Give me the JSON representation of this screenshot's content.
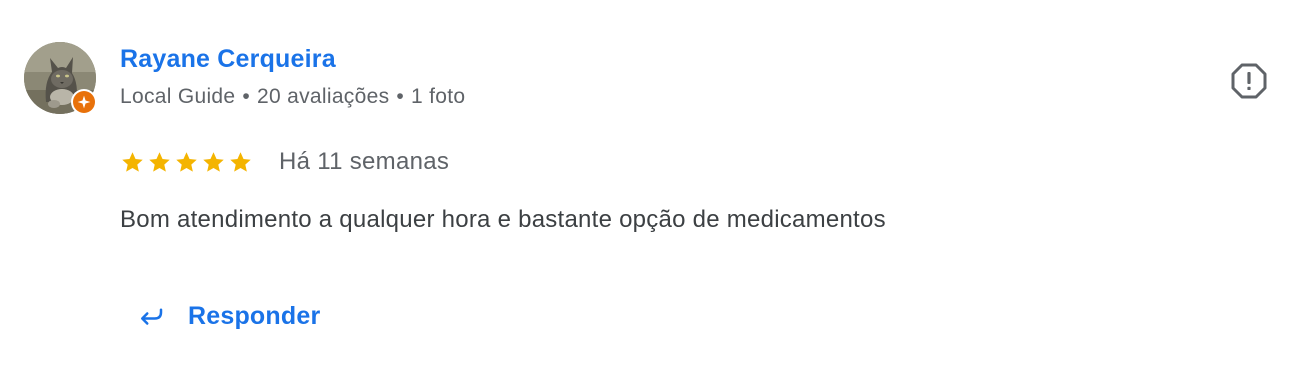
{
  "review": {
    "reviewer": {
      "name": "Rayane Cerqueira",
      "badge": "Local Guide",
      "separator": "•",
      "review_count": "20 avaliações",
      "photo_count": "1 foto",
      "avatar_icon": "cat-photo-avatar",
      "badge_icon": "local-guide-star-icon"
    },
    "rating": {
      "stars": 5,
      "max_stars": 5,
      "star_color": "#f4b400"
    },
    "date": "Há 11 semanas",
    "text": "Bom atendimento a qualquer hora e bastante opção de medicamentos",
    "actions": {
      "reply_label": "Responder",
      "reply_icon": "reply-arrow-icon",
      "flag_icon": "report-flag-icon"
    },
    "colors": {
      "link": "#1a73e8",
      "meta": "#5f6368",
      "body_text": "#3c4043",
      "badge": "#e8710a"
    }
  }
}
